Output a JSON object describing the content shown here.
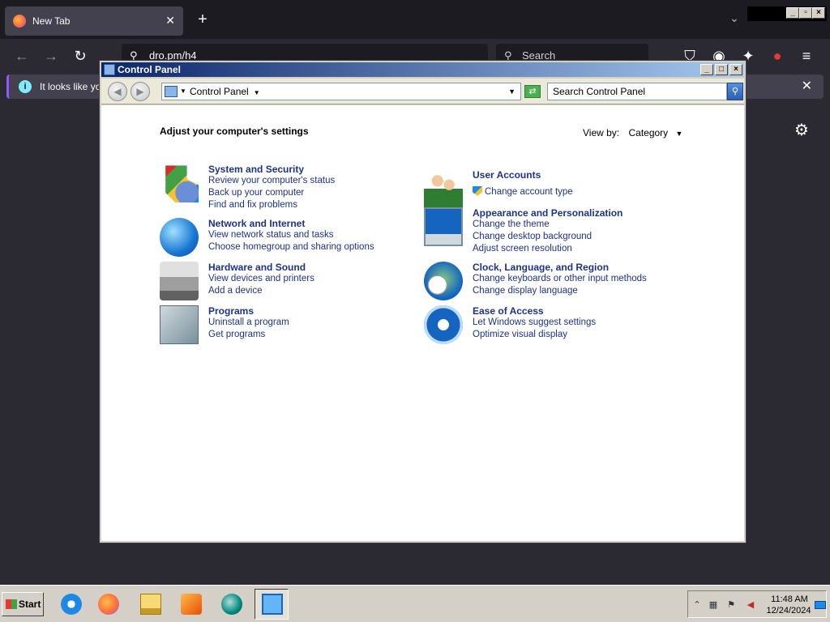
{
  "browser": {
    "tab_title": "New Tab",
    "url": "dro.pm/h4",
    "search_placeholder": "Search",
    "notification": "It looks like you"
  },
  "window": {
    "title": "Control Panel",
    "breadcrumb": "Control Panel",
    "search_placeholder": "Search Control Panel"
  },
  "content": {
    "heading": "Adjust your computer's settings",
    "view_by_label": "View by:",
    "view_by_value": "Category",
    "left_categories": [
      {
        "title": "System and Security",
        "icon": "shield-icon",
        "links": [
          "Review your computer's status",
          "Back up your computer",
          "Find and fix problems"
        ]
      },
      {
        "title": "Network and Internet",
        "icon": "network-globe-icon",
        "links": [
          "View network status and tasks",
          "Choose homegroup and sharing options"
        ]
      },
      {
        "title": "Hardware and Sound",
        "icon": "printer-icon",
        "links": [
          "View devices and printers",
          "Add a device"
        ]
      },
      {
        "title": "Programs",
        "icon": "programs-box-icon",
        "links": [
          "Uninstall a program",
          "Get programs"
        ]
      }
    ],
    "right_categories": [
      {
        "title": "User Accounts",
        "icon": "users-icon",
        "links": [
          "Change account type"
        ]
      },
      {
        "title": "Appearance and Personalization",
        "icon": "monitor-icon",
        "links": [
          "Change the theme",
          "Change desktop background",
          "Adjust screen resolution"
        ]
      },
      {
        "title": "Clock, Language, and Region",
        "icon": "clock-globe-icon",
        "links": [
          "Change keyboards or other input methods",
          "Change display language"
        ]
      },
      {
        "title": "Ease of Access",
        "icon": "ease-of-access-icon",
        "links": [
          "Let Windows suggest settings",
          "Optimize visual display"
        ]
      }
    ]
  },
  "taskbar": {
    "start_label": "Start",
    "time": "11:48 AM",
    "date": "12/24/2024"
  }
}
